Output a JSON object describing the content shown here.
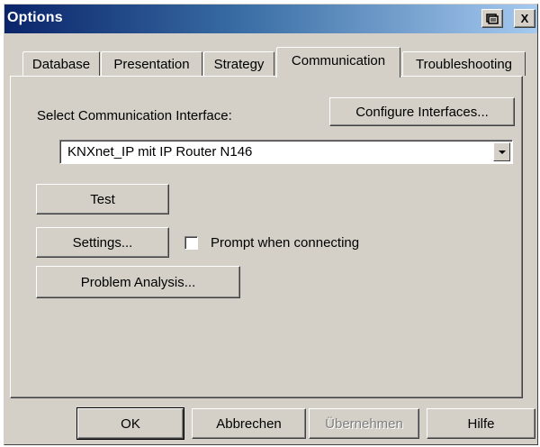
{
  "window": {
    "title": "Options",
    "help_icon": "help-icon",
    "close_glyph": "X"
  },
  "tabs": [
    {
      "label": "Database",
      "active": false
    },
    {
      "label": "Presentation",
      "active": false
    },
    {
      "label": "Strategy",
      "active": false
    },
    {
      "label": "Communication",
      "active": true
    },
    {
      "label": "Troubleshooting",
      "active": false
    }
  ],
  "communication": {
    "select_label": "Select Communication Interface:",
    "configure_button": "Configure Interfaces...",
    "interface_value": "KNXnet_IP mit IP Router N146",
    "test_button": "Test",
    "settings_button": "Settings...",
    "prompt_checkbox_label": "Prompt when connecting",
    "prompt_checked": false,
    "problem_analysis_button": "Problem Analysis..."
  },
  "footer": {
    "ok": "OK",
    "cancel": "Abbrechen",
    "apply": "Übernehmen",
    "help": "Hilfe"
  },
  "colors": {
    "face": "#d4d0c8",
    "title_start": "#0a246a",
    "title_end": "#a6caf0"
  }
}
